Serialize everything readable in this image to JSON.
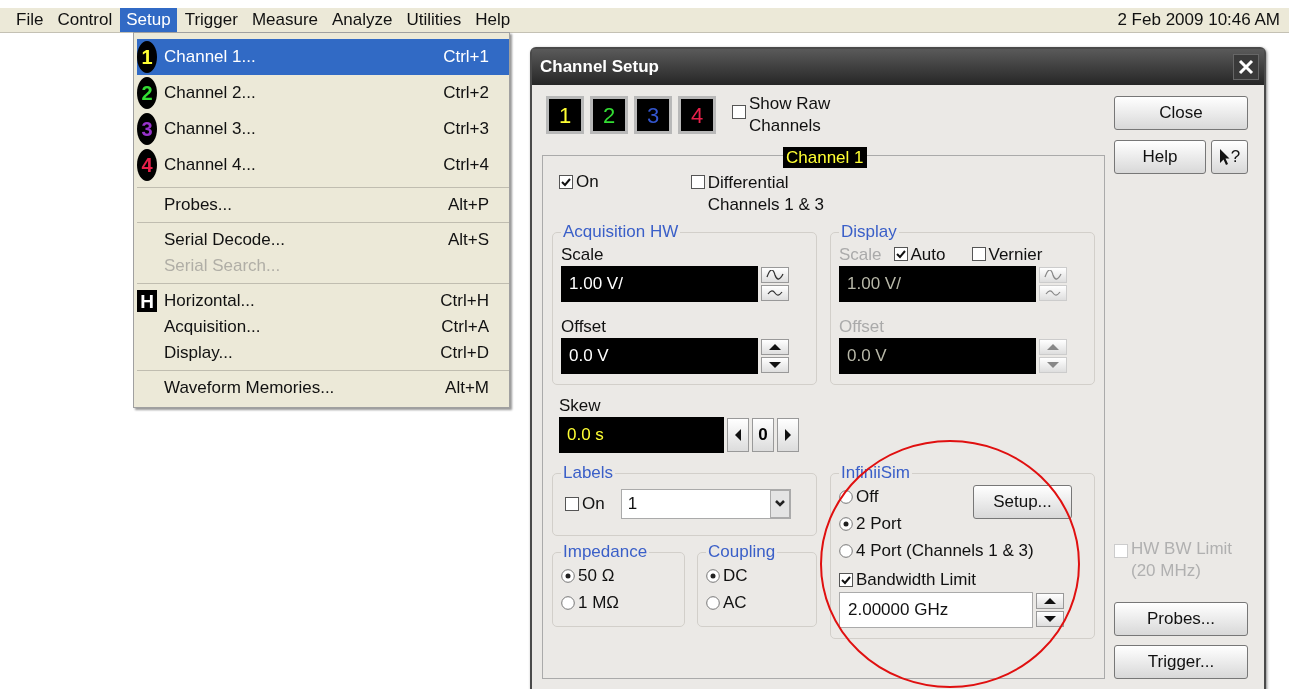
{
  "menu_bar": {
    "items": [
      {
        "label": "File",
        "selected": false
      },
      {
        "label": "Control",
        "selected": false
      },
      {
        "label": "Setup",
        "selected": true
      },
      {
        "label": "Trigger",
        "selected": false
      },
      {
        "label": "Measure",
        "selected": false
      },
      {
        "label": "Analyze",
        "selected": false
      },
      {
        "label": "Utilities",
        "selected": false
      },
      {
        "label": "Help",
        "selected": false
      }
    ],
    "datetime": "2 Feb 2009 10:46 AM"
  },
  "setup_menu": {
    "sections": [
      {
        "items": [
          {
            "label": "Channel 1...",
            "shortcut": "Ctrl+1",
            "badge": {
              "kind": "oval",
              "text": "1",
              "color": "#ffff33"
            },
            "selected": true,
            "disabled": false
          },
          {
            "label": "Channel 2...",
            "shortcut": "Ctrl+2",
            "badge": {
              "kind": "oval",
              "text": "2",
              "color": "#33dd33"
            },
            "selected": false,
            "disabled": false
          },
          {
            "label": "Channel 3...",
            "shortcut": "Ctrl+3",
            "badge": {
              "kind": "oval",
              "text": "3",
              "color": "#9933cc"
            },
            "selected": false,
            "disabled": false
          },
          {
            "label": "Channel 4...",
            "shortcut": "Ctrl+4",
            "badge": {
              "kind": "oval",
              "text": "4",
              "color": "#e8204a"
            },
            "selected": false,
            "disabled": false
          }
        ]
      },
      {
        "items": [
          {
            "label": "Probes...",
            "shortcut": "Alt+P",
            "selected": false,
            "disabled": false
          }
        ]
      },
      {
        "items": [
          {
            "label": "Serial Decode...",
            "shortcut": "Alt+S",
            "selected": false,
            "disabled": false
          },
          {
            "label": "Serial Search...",
            "selected": false,
            "disabled": true
          }
        ]
      },
      {
        "items": [
          {
            "label": "Horizontal...",
            "shortcut": "Ctrl+H",
            "badge": {
              "kind": "square",
              "text": "H",
              "color": "#ffffff"
            },
            "selected": false,
            "disabled": false
          },
          {
            "label": "Acquisition...",
            "shortcut": "Ctrl+A",
            "selected": false,
            "disabled": false
          },
          {
            "label": "Display...",
            "shortcut": "Ctrl+D",
            "selected": false,
            "disabled": false
          }
        ]
      },
      {
        "items": [
          {
            "label": "Waveform Memories...",
            "shortcut": "Alt+M",
            "selected": false,
            "disabled": false
          }
        ]
      }
    ]
  },
  "dialog": {
    "title": "Channel Setup",
    "channel_buttons": [
      {
        "label": "1",
        "color": "#ffff33"
      },
      {
        "label": "2",
        "color": "#33dd33"
      },
      {
        "label": "3",
        "color": "#3355cc"
      },
      {
        "label": "4",
        "color": "#e8204a"
      }
    ],
    "show_raw_channels": {
      "label": "Show Raw Channels",
      "checked": false
    },
    "panel_tab": "Channel 1",
    "on": {
      "label": "On",
      "checked": true
    },
    "differential": {
      "label": "Differential Channels 1 & 3",
      "checked": false
    },
    "acquisition_hw": {
      "title": "Acquisition HW",
      "scale_label": "Scale",
      "scale_value": "1.00 V/",
      "offset_label": "Offset",
      "offset_value": "0.0 V"
    },
    "display": {
      "title": "Display",
      "disabled": true,
      "scale_label": "Scale",
      "auto": {
        "label": "Auto",
        "checked": true
      },
      "vernier": {
        "label": "Vernier",
        "checked": false
      },
      "scale_value": "1.00 V/",
      "offset_label": "Offset",
      "offset_value": "0.0 V"
    },
    "skew": {
      "label": "Skew",
      "value": "0.0 s",
      "step": "0"
    },
    "labels": {
      "title": "Labels",
      "on": {
        "label": "On",
        "checked": false
      },
      "value": "1"
    },
    "impedance": {
      "title": "Impedance",
      "options": [
        {
          "label": "50 Ω",
          "selected": true
        },
        {
          "label": "1 MΩ",
          "selected": false
        }
      ]
    },
    "coupling": {
      "title": "Coupling",
      "options": [
        {
          "label": "DC",
          "selected": true
        },
        {
          "label": "AC",
          "selected": false
        }
      ]
    },
    "infiniisim": {
      "title": "InfiniiSim",
      "options": [
        {
          "label": "Off",
          "selected": false
        },
        {
          "label": "2 Port",
          "selected": true
        },
        {
          "label": "4 Port (Channels 1 & 3)",
          "selected": false
        }
      ],
      "setup_button": "Setup...",
      "bandwidth_limit": {
        "label": "Bandwidth Limit",
        "checked": true
      },
      "bandwidth_value": "2.00000 GHz"
    },
    "buttons": {
      "close": "Close",
      "help": "Help",
      "whats_this": "?",
      "probes": "Probes...",
      "trigger": "Trigger..."
    },
    "hw_bw_limit": {
      "label": "HW BW Limit (20 MHz)",
      "checked": false,
      "disabled": true
    }
  }
}
